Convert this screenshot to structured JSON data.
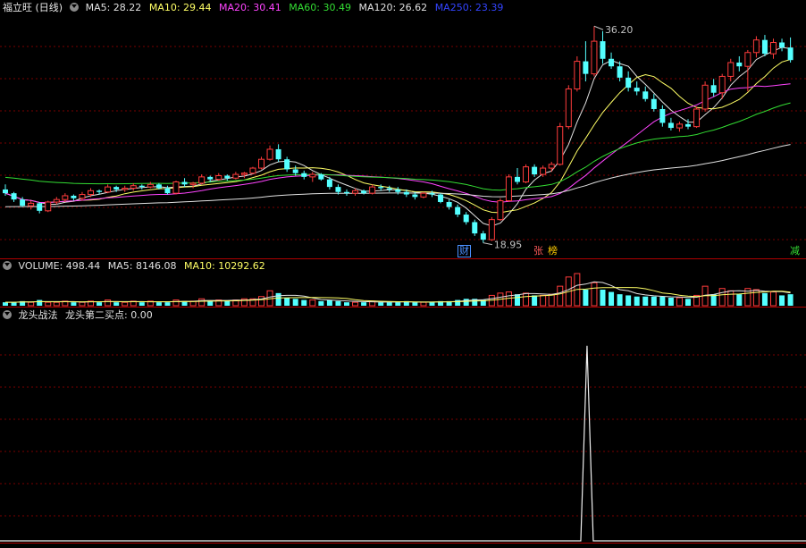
{
  "main_panel": {
    "title": "福立旺 (日线)",
    "ma_labels": [
      {
        "text": "MA5: 28.22",
        "color": "#e0e0e0"
      },
      {
        "text": "MA10: 29.44",
        "color": "#ffff66"
      },
      {
        "text": "MA20: 30.41",
        "color": "#ff44ff"
      },
      {
        "text": "MA60: 30.49",
        "color": "#33dd33"
      },
      {
        "text": "MA120: 26.62",
        "color": "#e0e0e0"
      },
      {
        "text": "MA250: 23.39",
        "color": "#3344ff"
      }
    ],
    "high_label": "36.20",
    "low_label": "18.95",
    "event_markers": [
      {
        "text": "财",
        "color": "#4a90ff"
      },
      {
        "text": "张",
        "color": "#ff5a5a"
      },
      {
        "text": "榜",
        "color": "#ffcc00"
      },
      {
        "text": "减",
        "color": "#33dd33"
      }
    ]
  },
  "volume_panel": {
    "label": "VOLUME: 498.44",
    "ma5": "MA5: 8146.08",
    "ma10": "MA10: 10292.62"
  },
  "indicator_panel": {
    "name": "龙头战法",
    "series_label": "龙头第二买点: 0.00"
  },
  "colors": {
    "up": "#ff3c3c",
    "down": "#54ffff",
    "ma5": "#e0e0e0",
    "ma10": "#ffff66",
    "ma20": "#ff44ff",
    "ma60": "#33dd33",
    "ma120": "#e0e0e0",
    "ma250": "#3344ff",
    "grid": "#7a0000",
    "separator": "#b00000"
  },
  "chart_data": [
    {
      "type": "candlestick",
      "title": "福立旺 (日线)",
      "ylim": [
        18,
        37
      ],
      "price_max": 36.2,
      "price_min": 18.95,
      "candles": [
        [
          23.2,
          23.6,
          22.7,
          22.9
        ],
        [
          22.9,
          23.0,
          22.2,
          22.4
        ],
        [
          22.4,
          22.6,
          21.8,
          21.9
        ],
        [
          21.9,
          22.3,
          21.6,
          22.1
        ],
        [
          22.1,
          22.2,
          21.3,
          21.5
        ],
        [
          21.5,
          22.3,
          21.4,
          22.2
        ],
        [
          22.2,
          22.6,
          22.0,
          22.4
        ],
        [
          22.4,
          22.9,
          22.2,
          22.7
        ],
        [
          22.7,
          22.8,
          22.3,
          22.5
        ],
        [
          22.5,
          23.0,
          22.3,
          22.8
        ],
        [
          22.8,
          23.3,
          22.6,
          23.1
        ],
        [
          23.1,
          23.2,
          22.8,
          23.0
        ],
        [
          23.0,
          23.6,
          22.9,
          23.4
        ],
        [
          23.4,
          23.5,
          23.0,
          23.2
        ],
        [
          23.2,
          23.5,
          23.0,
          23.3
        ],
        [
          23.3,
          23.7,
          23.1,
          23.5
        ],
        [
          23.5,
          23.6,
          23.2,
          23.4
        ],
        [
          23.4,
          23.8,
          23.3,
          23.6
        ],
        [
          23.6,
          23.7,
          23.2,
          23.3
        ],
        [
          23.3,
          23.5,
          22.8,
          22.9
        ],
        [
          22.9,
          23.9,
          22.8,
          23.8
        ],
        [
          23.8,
          24.1,
          23.4,
          23.6
        ],
        [
          23.6,
          23.8,
          23.3,
          23.7
        ],
        [
          23.7,
          24.4,
          23.6,
          24.2
        ],
        [
          24.2,
          24.3,
          23.8,
          24.0
        ],
        [
          24.0,
          24.5,
          23.9,
          24.3
        ],
        [
          24.3,
          24.4,
          23.9,
          24.1
        ],
        [
          24.1,
          24.6,
          24.0,
          24.4
        ],
        [
          24.4,
          24.6,
          24.1,
          24.5
        ],
        [
          24.5,
          25.0,
          24.4,
          24.9
        ],
        [
          24.9,
          25.8,
          24.8,
          25.6
        ],
        [
          25.6,
          26.7,
          25.5,
          26.4
        ],
        [
          26.4,
          26.8,
          25.4,
          25.6
        ],
        [
          25.6,
          25.8,
          24.6,
          24.8
        ],
        [
          24.8,
          25.1,
          24.3,
          24.5
        ],
        [
          24.5,
          24.7,
          24.0,
          24.2
        ],
        [
          24.2,
          24.6,
          23.8,
          24.4
        ],
        [
          24.4,
          24.5,
          23.9,
          24.0
        ],
        [
          24.0,
          24.2,
          23.2,
          23.4
        ],
        [
          23.4,
          23.6,
          22.8,
          23.0
        ],
        [
          23.0,
          23.2,
          22.7,
          22.9
        ],
        [
          22.9,
          23.3,
          22.7,
          23.1
        ],
        [
          23.1,
          23.2,
          22.8,
          22.9
        ],
        [
          22.9,
          23.6,
          22.8,
          23.4
        ],
        [
          23.4,
          23.6,
          23.1,
          23.3
        ],
        [
          23.3,
          23.5,
          23.0,
          23.2
        ],
        [
          23.2,
          23.4,
          22.8,
          23.0
        ],
        [
          23.0,
          23.2,
          22.6,
          22.8
        ],
        [
          22.8,
          23.0,
          22.4,
          22.6
        ],
        [
          22.6,
          23.0,
          22.5,
          22.9
        ],
        [
          22.9,
          23.1,
          22.6,
          22.8
        ],
        [
          22.8,
          22.9,
          22.1,
          22.2
        ],
        [
          22.2,
          22.4,
          21.6,
          21.8
        ],
        [
          21.8,
          22.0,
          21.0,
          21.2
        ],
        [
          21.2,
          21.4,
          20.4,
          20.6
        ],
        [
          20.6,
          20.8,
          19.5,
          19.7
        ],
        [
          19.7,
          19.9,
          18.95,
          19.2
        ],
        [
          19.2,
          21.0,
          19.1,
          20.8
        ],
        [
          20.8,
          22.5,
          20.7,
          22.3
        ],
        [
          22.3,
          24.4,
          22.2,
          24.2
        ],
        [
          24.2,
          24.9,
          23.6,
          23.8
        ],
        [
          23.8,
          25.2,
          23.7,
          25.0
        ],
        [
          25.0,
          25.2,
          24.2,
          24.4
        ],
        [
          24.4,
          25.1,
          24.2,
          24.9
        ],
        [
          24.9,
          25.4,
          24.6,
          25.2
        ],
        [
          25.2,
          28.5,
          25.1,
          28.2
        ],
        [
          28.2,
          31.5,
          28.0,
          31.2
        ],
        [
          31.2,
          33.8,
          31.0,
          33.4
        ],
        [
          33.4,
          35.0,
          31.8,
          32.4
        ],
        [
          32.4,
          36.2,
          32.2,
          35.0
        ],
        [
          35.0,
          35.8,
          33.2,
          33.6
        ],
        [
          33.6,
          34.1,
          32.8,
          33.0
        ],
        [
          33.0,
          33.4,
          31.8,
          32.1
        ],
        [
          32.1,
          32.6,
          31.0,
          31.3
        ],
        [
          31.3,
          31.8,
          30.7,
          31.0
        ],
        [
          31.0,
          31.4,
          30.2,
          30.4
        ],
        [
          30.4,
          30.8,
          29.4,
          29.6
        ],
        [
          29.6,
          29.9,
          28.2,
          28.5
        ],
        [
          28.5,
          28.9,
          27.9,
          28.1
        ],
        [
          28.1,
          28.6,
          27.8,
          28.4
        ],
        [
          28.4,
          28.8,
          28.0,
          28.2
        ],
        [
          28.2,
          29.8,
          28.1,
          29.6
        ],
        [
          29.6,
          31.8,
          29.4,
          31.5
        ],
        [
          31.5,
          32.0,
          30.6,
          30.9
        ],
        [
          30.9,
          32.4,
          30.4,
          32.2
        ],
        [
          32.2,
          33.6,
          31.8,
          33.3
        ],
        [
          33.3,
          33.8,
          32.6,
          33.0
        ],
        [
          33.0,
          34.3,
          31.0,
          34.1
        ],
        [
          34.1,
          35.4,
          33.7,
          35.1
        ],
        [
          35.1,
          35.5,
          33.8,
          34.0
        ],
        [
          34.0,
          35.2,
          33.6,
          34.9
        ],
        [
          34.9,
          35.2,
          34.2,
          34.5
        ],
        [
          34.5,
          35.3,
          33.3,
          33.5
        ]
      ],
      "ma_period_labels": [
        "MA5",
        "MA10",
        "MA20",
        "MA60",
        "MA120",
        "MA250"
      ],
      "ma_values": [
        28.22,
        29.44,
        30.41,
        30.49,
        26.62,
        23.39
      ]
    },
    {
      "type": "bar",
      "title": "VOLUME",
      "volume": [
        3,
        3,
        4,
        3,
        5,
        3,
        3,
        4,
        3,
        3,
        4,
        3,
        5,
        3,
        3,
        4,
        3,
        4,
        3,
        3,
        5,
        4,
        4,
        6,
        4,
        5,
        4,
        5,
        6,
        6,
        8,
        13,
        11,
        7,
        6,
        5,
        5,
        4,
        5,
        4,
        3,
        3,
        3,
        4,
        3,
        3,
        3,
        4,
        3,
        3,
        3,
        4,
        4,
        5,
        6,
        6,
        5,
        9,
        11,
        12,
        10,
        11,
        9,
        9,
        10,
        17,
        25,
        28,
        14,
        20,
        14,
        12,
        10,
        9,
        8,
        8,
        8,
        8,
        7,
        7,
        6,
        9,
        17,
        10,
        15,
        13,
        10,
        15,
        14,
        11,
        12,
        9,
        10
      ],
      "ma5": 8146.08,
      "ma10": 10292.62,
      "last": 498.44
    },
    {
      "type": "line",
      "title": "龙头战法",
      "series": [
        {
          "name": "龙头第二买点",
          "spike_index": 69,
          "spike_value": 1,
          "last": 0.0
        }
      ],
      "ylim": [
        0,
        1.1
      ]
    }
  ]
}
